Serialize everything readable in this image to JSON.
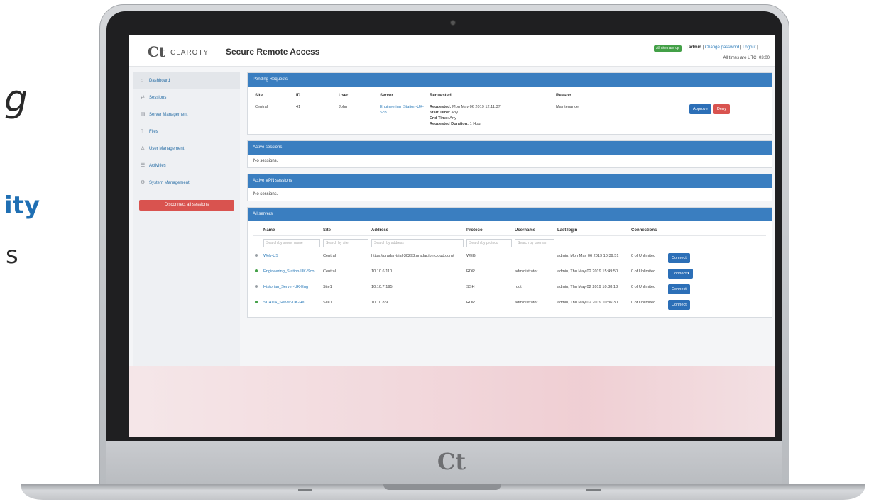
{
  "background_text": {
    "frag_g": "g",
    "frag_ity": "ity",
    "frag_s": "s"
  },
  "laptop": {
    "chin_logo": "Ct"
  },
  "header": {
    "logo_mark": "Ct",
    "brand": "CLAROTY",
    "title": "Secure Remote Access",
    "status_badge": "All sites are up",
    "user": "admin",
    "change_password": "Change password",
    "logout": "Logout",
    "timezone": "All times are UTC+03:00"
  },
  "sidebar": {
    "items": [
      {
        "label": "Dashboard",
        "icon": "home-icon"
      },
      {
        "label": "Sessions",
        "icon": "sessions-icon"
      },
      {
        "label": "Server Management",
        "icon": "server-icon"
      },
      {
        "label": "Files",
        "icon": "files-icon"
      },
      {
        "label": "User Management",
        "icon": "user-icon"
      },
      {
        "label": "Activities",
        "icon": "list-icon"
      },
      {
        "label": "System Management",
        "icon": "gear-icon"
      }
    ],
    "disconnect_label": "Disconnect all sessions"
  },
  "pending": {
    "title": "Pending Requests",
    "headers": [
      "Site",
      "ID",
      "User",
      "Server",
      "Requested",
      "Reason"
    ],
    "row": {
      "site": "Central",
      "id": "41",
      "user": "John",
      "server": "Engineering_Station-UK-Sco",
      "requested_label": "Requested:",
      "requested_value": "Mon May 06 2019 12:11:37",
      "start_label": "Start Time:",
      "start_value": "Any",
      "end_label": "End Time:",
      "end_value": "Any",
      "duration_label": "Requested Duration:",
      "duration_value": "1 Hour",
      "reason": "Maintenance",
      "approve": "Approve",
      "deny": "Deny"
    }
  },
  "active_sessions": {
    "title": "Active sessions",
    "empty": "No sessions."
  },
  "active_vpn": {
    "title": "Active VPN sessions",
    "empty": "No sessions."
  },
  "servers": {
    "title": "All servers",
    "headers": [
      "Name",
      "Site",
      "Address",
      "Protocol",
      "Username",
      "Last login",
      "Connections"
    ],
    "search": [
      "Search by server name",
      "Search by site",
      "Search by address",
      "Search by protoco",
      "Search by usernar"
    ],
    "rows": [
      {
        "name": "Web-US",
        "site": "Central",
        "address": "https://qradar-trial-30293.qradar.ibmcloud.com/",
        "protocol": "WEB",
        "username": "",
        "last_login": "admin, Mon May 06 2019 10:39:51",
        "connections": "0 of Unlimited",
        "action": "Connect",
        "status": "grey"
      },
      {
        "name": "Engineering_Station-UK-Sco",
        "site": "Central",
        "address": "10.10.6.110",
        "protocol": "RDP",
        "username": "administrator",
        "last_login": "admin, Thu May 02 2019 15:49:50",
        "connections": "0 of Unlimited",
        "action": "Connect",
        "status": "green"
      },
      {
        "name": "Historian_Server-UK-Eng",
        "site": "Site1",
        "address": "10.10.7.195",
        "protocol": "SSH",
        "username": "root",
        "last_login": "admin, Thu May 02 2019 10:38:13",
        "connections": "0 of Unlimited",
        "action": "Connect",
        "status": "grey"
      },
      {
        "name": "SCADA_Server-UK-He",
        "site": "Site1",
        "address": "10.10.8.9",
        "protocol": "RDP",
        "username": "administrator",
        "last_login": "admin, Thu May 02 2019 10:36:30",
        "connections": "0 of Unlimited",
        "action": "Connect",
        "status": "green"
      }
    ]
  }
}
